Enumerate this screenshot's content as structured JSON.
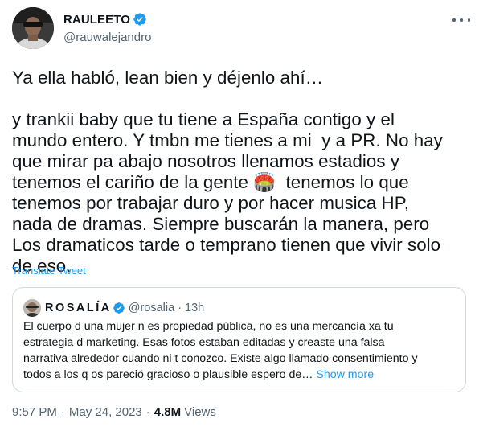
{
  "author": {
    "display_name": "RAULEETO",
    "handle": "@rauwalejandro",
    "verified": true
  },
  "tweet": {
    "text_lines": [
      "Ya ella habló, lean bien y déjenlo ahí…",
      "",
      "y trankii baby que tu tiene a España contigo y el",
      "mundo entero. Y tmbn me tienes a mi  y a PR. No hay",
      "que mirar pa abajo nosotros llenamos estadios y",
      "tenemos el cariño de la gente 🏟️  tenemos lo que",
      "tenemos por trabajar duro y por hacer musica HP,",
      "nada de dramas. Siempre buscarán la manera, pero",
      "Los dramaticos tarde o temprano tienen que vivir solo",
      "de eso."
    ],
    "translate_label": "Translate Tweet"
  },
  "quote": {
    "display_name": "ROSALÍA",
    "handle": "@rosalia",
    "separator": "·",
    "time": "13h",
    "text_lines": [
      "El cuerpo d una mujer n es propiedad pública, no es una mercancía xa tu",
      "estrategia d marketing. Esas fotos estaban editadas y creaste una falsa",
      "narrativa alrededor cuando ni t conozco. Existe algo llamado consentimiento y",
      "todos a los q os pareció gracioso o plausible espero de… "
    ],
    "show_more_label": "Show more"
  },
  "meta": {
    "time": "9:57 PM",
    "separator": "·",
    "date": "May 24, 2023",
    "views_count": "4.8M",
    "views_label": "Views"
  },
  "colors": {
    "accent": "#1d9bf0",
    "secondary_text": "#536471",
    "border": "#cfd9de"
  },
  "icons": {
    "verified": "verified-badge-icon",
    "more": "more-options-icon"
  }
}
